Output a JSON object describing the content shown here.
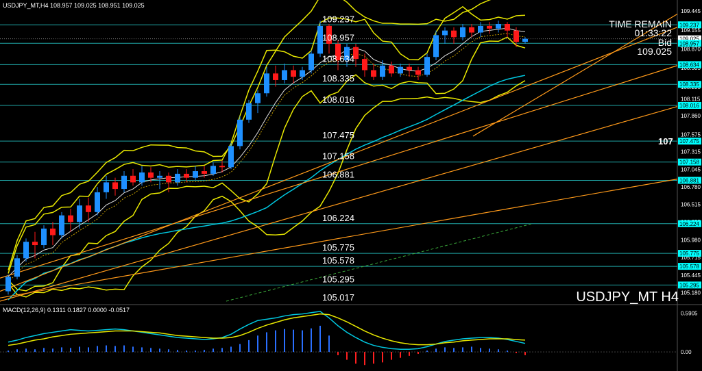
{
  "header": {
    "main_label": "USDJPY_MT,H4  108.957 109.025 108.951 109.025",
    "macd_label": "MACD(12,26,9) 0.1311 0.1827 0.0000 -0.0517"
  },
  "overlay": {
    "time_remain_label": "TIME REMAIN",
    "time_remain_value": "01:33:22",
    "bid_label": "Bid",
    "bid_value": "109.025",
    "symbol_title": "USDJPY_MT H4",
    "marker_107": "107"
  },
  "colors": {
    "background": "#000000",
    "bull_candle": "#1e90ff",
    "bear_candle": "#ff1a1a",
    "level_line": "#1fa5a5",
    "level_text": "#ffffff",
    "axis_text": "#ffffff",
    "price_tag_bg": "#00ffff",
    "bollinger": "#e8e800",
    "ma_cyan": "#00c8e0",
    "ma_white": "#e0e0e0",
    "trend_orange": "#ff9a1a",
    "macd_main": "#00c8e0",
    "macd_signal": "#e8e800",
    "macd_hist_pos": "#2a6fff",
    "macd_hist_neg": "#ff2020"
  },
  "chart_data": [
    {
      "type": "candlestick",
      "ylim": [
        105.05,
        109.53
      ],
      "y_axis_ticks": [
        "109.445",
        "109.155",
        "108.870",
        "108.585",
        "108.295",
        "108.115",
        "107.860",
        "107.575",
        "107.315",
        "107.045",
        "106.780",
        "106.515",
        "106.255",
        "105.980",
        "105.715",
        "105.445",
        "105.180"
      ],
      "levels": [
        109.237,
        108.957,
        108.634,
        108.335,
        108.016,
        107.475,
        107.158,
        106.881,
        106.224,
        105.775,
        105.578,
        105.295
      ],
      "level_labels": [
        "109.237",
        "108.957",
        "108.634",
        "108.335",
        "108.016",
        "107.475",
        "107.158",
        "106.881",
        "106.224",
        "105.775",
        "105.578",
        "105.295",
        "105.017"
      ],
      "right_tags": [
        "109.237",
        "109.025",
        "108.957",
        "108.634",
        "108.335",
        "108.016",
        "107.475",
        "107.158",
        "106.881",
        "106.224",
        "105.775",
        "105.578",
        "105.295"
      ],
      "current_price": 109.025,
      "candles": [
        [
          105.2,
          105.42,
          105.15,
          105.45
        ],
        [
          105.42,
          105.7,
          105.38,
          105.75
        ],
        [
          105.7,
          105.95,
          105.65,
          106.0
        ],
        [
          105.95,
          105.9,
          105.7,
          106.1
        ],
        [
          105.9,
          106.15,
          105.85,
          106.2
        ],
        [
          106.15,
          106.05,
          105.9,
          106.25
        ],
        [
          106.05,
          106.35,
          106.0,
          106.4
        ],
        [
          106.35,
          106.25,
          106.1,
          106.45
        ],
        [
          106.25,
          106.5,
          106.15,
          106.6
        ],
        [
          106.5,
          106.4,
          106.25,
          106.62
        ],
        [
          106.4,
          106.7,
          106.35,
          106.78
        ],
        [
          106.7,
          106.85,
          106.6,
          106.95
        ],
        [
          106.85,
          106.75,
          106.65,
          106.92
        ],
        [
          106.75,
          106.95,
          106.7,
          107.02
        ],
        [
          106.95,
          106.85,
          106.8,
          107.05
        ],
        [
          106.85,
          107.0,
          106.8,
          107.1
        ],
        [
          107.0,
          106.92,
          106.85,
          107.08
        ],
        [
          106.92,
          106.95,
          106.75,
          107.02
        ],
        [
          106.95,
          106.85,
          106.7,
          107.0
        ],
        [
          106.85,
          106.98,
          106.8,
          107.05
        ],
        [
          106.98,
          106.92,
          106.85,
          107.05
        ],
        [
          106.92,
          107.02,
          106.88,
          107.1
        ],
        [
          107.02,
          106.98,
          106.92,
          107.1
        ],
        [
          106.98,
          107.1,
          106.95,
          107.15
        ],
        [
          107.1,
          107.08,
          107.0,
          107.18
        ],
        [
          107.08,
          107.4,
          107.05,
          107.45
        ],
        [
          107.4,
          107.8,
          107.35,
          107.85
        ],
        [
          107.8,
          108.05,
          107.75,
          108.1
        ],
        [
          108.05,
          108.2,
          107.9,
          108.25
        ],
        [
          108.2,
          108.5,
          108.15,
          108.6
        ],
        [
          108.5,
          108.4,
          108.3,
          108.62
        ],
        [
          108.4,
          108.55,
          108.35,
          108.65
        ],
        [
          108.55,
          108.45,
          108.35,
          108.62
        ],
        [
          108.45,
          108.55,
          108.4,
          108.6
        ],
        [
          108.55,
          108.8,
          108.5,
          108.85
        ],
        [
          108.8,
          109.22,
          108.75,
          109.3
        ],
        [
          109.22,
          108.95,
          108.8,
          109.25
        ],
        [
          108.95,
          108.7,
          108.55,
          109.0
        ],
        [
          108.7,
          108.9,
          108.6,
          108.95
        ],
        [
          108.9,
          108.72,
          108.6,
          108.95
        ],
        [
          108.72,
          108.55,
          108.45,
          108.8
        ],
        [
          108.55,
          108.45,
          108.4,
          108.65
        ],
        [
          108.45,
          108.62,
          108.4,
          108.7
        ],
        [
          108.62,
          108.5,
          108.45,
          108.68
        ],
        [
          108.5,
          108.6,
          108.45,
          108.65
        ],
        [
          108.6,
          108.55,
          108.45,
          108.65
        ],
        [
          108.55,
          108.48,
          108.4,
          108.6
        ],
        [
          108.48,
          108.75,
          108.45,
          108.8
        ],
        [
          108.75,
          109.08,
          108.7,
          109.15
        ],
        [
          109.08,
          109.15,
          108.95,
          109.2
        ],
        [
          109.15,
          109.05,
          108.95,
          109.2
        ],
        [
          109.05,
          109.2,
          109.0,
          109.25
        ],
        [
          109.2,
          109.12,
          109.05,
          109.25
        ],
        [
          109.12,
          109.22,
          109.05,
          109.28
        ],
        [
          109.22,
          109.18,
          109.1,
          109.28
        ],
        [
          109.18,
          109.25,
          109.12,
          109.3
        ],
        [
          109.25,
          109.15,
          109.05,
          109.28
        ],
        [
          109.15,
          108.98,
          108.9,
          109.2
        ],
        [
          108.98,
          109.025,
          108.95,
          109.05
        ]
      ]
    },
    {
      "type": "macd",
      "ylim": [
        -0.25,
        0.65
      ],
      "y_axis_ticks": [
        "0.5905",
        "0.00"
      ],
      "histogram": [
        0.02,
        0.04,
        0.05,
        0.04,
        0.06,
        0.05,
        0.07,
        0.06,
        0.08,
        0.07,
        0.09,
        0.1,
        0.09,
        0.1,
        0.08,
        0.07,
        0.06,
        0.05,
        0.04,
        0.03,
        0.02,
        0.02,
        0.03,
        0.05,
        0.06,
        0.08,
        0.12,
        0.18,
        0.25,
        0.3,
        0.33,
        0.35,
        0.34,
        0.33,
        0.36,
        0.4,
        0.25,
        -0.05,
        -0.12,
        -0.18,
        -0.2,
        -0.18,
        -0.16,
        -0.12,
        -0.09,
        -0.06,
        -0.03,
        0.02,
        0.05,
        0.07,
        0.06,
        0.07,
        0.08,
        0.06,
        0.05,
        0.04,
        0.02,
        -0.02,
        -0.05
      ],
      "main": [
        0.15,
        0.18,
        0.22,
        0.25,
        0.28,
        0.3,
        0.32,
        0.34,
        0.33,
        0.32,
        0.33,
        0.34,
        0.35,
        0.34,
        0.32,
        0.3,
        0.28,
        0.26,
        0.24,
        0.22,
        0.21,
        0.2,
        0.19,
        0.2,
        0.22,
        0.27,
        0.35,
        0.42,
        0.48,
        0.5,
        0.52,
        0.55,
        0.57,
        0.58,
        0.6,
        0.62,
        0.52,
        0.4,
        0.3,
        0.22,
        0.15,
        0.1,
        0.07,
        0.05,
        0.04,
        0.04,
        0.05,
        0.08,
        0.12,
        0.16,
        0.18,
        0.2,
        0.21,
        0.22,
        0.22,
        0.21,
        0.19,
        0.16,
        0.13
      ],
      "signal": [
        0.1,
        0.12,
        0.15,
        0.18,
        0.2,
        0.23,
        0.25,
        0.27,
        0.28,
        0.29,
        0.3,
        0.31,
        0.32,
        0.32,
        0.32,
        0.31,
        0.3,
        0.29,
        0.27,
        0.25,
        0.24,
        0.23,
        0.22,
        0.21,
        0.21,
        0.22,
        0.25,
        0.3,
        0.36,
        0.41,
        0.45,
        0.49,
        0.52,
        0.54,
        0.56,
        0.58,
        0.57,
        0.52,
        0.46,
        0.39,
        0.32,
        0.26,
        0.21,
        0.17,
        0.14,
        0.12,
        0.11,
        0.11,
        0.12,
        0.14,
        0.15,
        0.17,
        0.18,
        0.19,
        0.2,
        0.2,
        0.2,
        0.19,
        0.18
      ]
    }
  ]
}
